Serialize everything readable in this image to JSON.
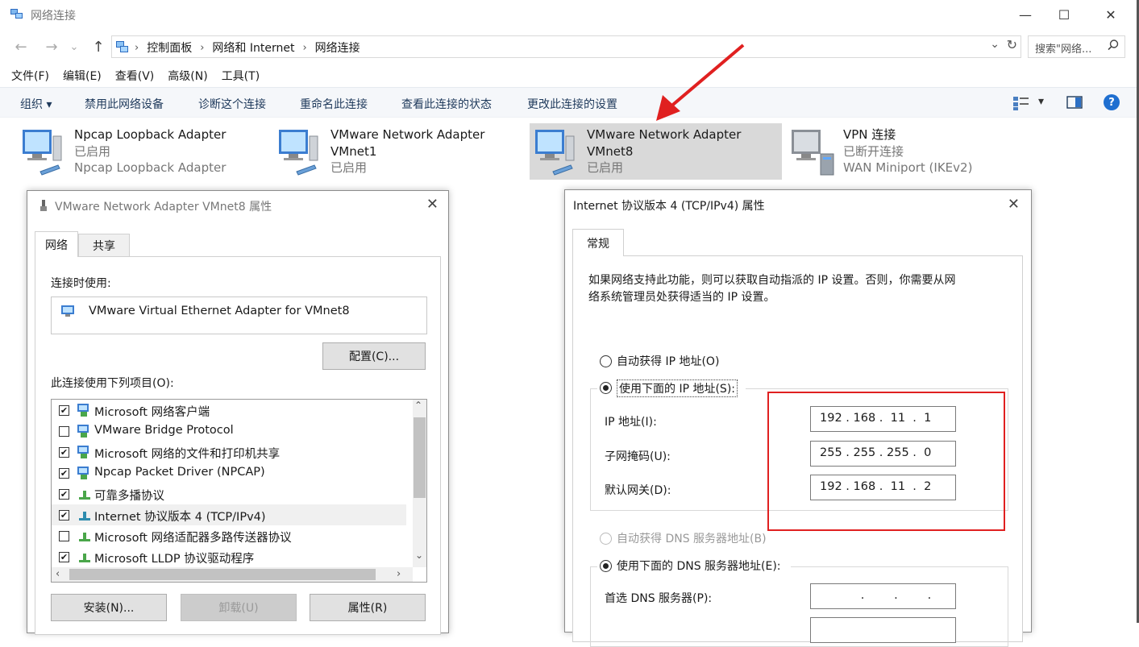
{
  "window": {
    "title": "网络连接",
    "minimize": "—",
    "maximize": "☐",
    "close": "✕"
  },
  "nav": {
    "back": "←",
    "forward": "→",
    "history": "⌄",
    "up": "↑"
  },
  "breadcrumbs": [
    "控制面板",
    "网络和 Internet",
    "网络连接"
  ],
  "breadcrumb_sep": "›",
  "address": {
    "dropdown": "⌄",
    "refresh": "↻"
  },
  "search": {
    "placeholder": "搜索\"网络...",
    "icon": "search-icon"
  },
  "menu": [
    "文件(F)",
    "编辑(E)",
    "查看(V)",
    "高级(N)",
    "工具(T)"
  ],
  "commands": {
    "organize": "组织 ▾",
    "disable": "禁用此网络设备",
    "diagnose": "诊断这个连接",
    "rename": "重命名此连接",
    "view_status": "查看此连接的状态",
    "change_settings": "更改此连接的设置",
    "view_dropdown": "▾"
  },
  "adapters": [
    {
      "line1": "Npcap Loopback Adapter",
      "line2": "已启用",
      "line3": "Npcap Loopback Adapter"
    },
    {
      "line1": "VMware Network Adapter",
      "line2": "VMnet1",
      "line3": "已启用"
    },
    {
      "line1": "VMware Network Adapter",
      "line2": "VMnet8",
      "line3": "已启用"
    },
    {
      "line1": "VPN 连接",
      "line2": "已断开连接",
      "line3": "WAN Miniport (IKEv2)"
    }
  ],
  "props_dialog": {
    "title": "VMware Network Adapter VMnet8 属性",
    "close": "✕",
    "tabs": [
      "网络",
      "共享"
    ],
    "connect_using_label": "连接时使用:",
    "adapter_name": "VMware Virtual Ethernet Adapter for VMnet8",
    "configure_button": "配置(C)...",
    "items_label": "此连接使用下列项目(O):",
    "items": [
      {
        "label": "Microsoft 网络客户端",
        "checked": "✔"
      },
      {
        "label": "VMware Bridge Protocol",
        "checked": ""
      },
      {
        "label": "Microsoft 网络的文件和打印机共享",
        "checked": "✔"
      },
      {
        "label": "Npcap Packet Driver (NPCAP)",
        "checked": "✔"
      },
      {
        "label": "可靠多播协议",
        "checked": "✔"
      },
      {
        "label": "Internet 协议版本 4 (TCP/IPv4)",
        "checked": "✔"
      },
      {
        "label": "Microsoft 网络适配器多路传送器协议",
        "checked": ""
      },
      {
        "label": "Microsoft LLDP 协议驱动程序",
        "checked": "✔"
      }
    ],
    "scroll_up": "⌃",
    "scroll_down": "⌄",
    "scroll_left": "‹",
    "scroll_right": "›",
    "install_button": "安装(N)...",
    "uninstall_button": "卸载(U)",
    "properties_button": "属性(R)"
  },
  "ipv4_dialog": {
    "title": "Internet 协议版本 4 (TCP/IPv4) 属性",
    "close": "✕",
    "tab": "常规",
    "description_line1": "如果网络支持此功能，则可以获取自动指派的 IP 设置。否则，你需要从网",
    "description_line2": "络系统管理员处获得适当的 IP 设置。",
    "auto_ip": "自动获得 IP 地址(O)",
    "manual_ip": "使用下面的 IP 地址(S):",
    "ip_label": "IP 地址(I):",
    "mask_label": "子网掩码(U):",
    "gateway_label": "默认网关(D):",
    "ip_value": "192 . 168 .  11  .  1",
    "mask_value": "255 . 255 . 255 .  0",
    "gateway_value": "192 . 168 .  11  .  2",
    "auto_dns": "自动获得 DNS 服务器地址(B)",
    "manual_dns": "使用下面的 DNS 服务器地址(E):",
    "preferred_dns_label": "首选 DNS 服务器(P):",
    "preferred_dns_value": "           .        .        ."
  },
  "colors": {
    "annotation_red": "#e02020",
    "selection": "#d9d9d9",
    "help_blue": "#1f6fd0"
  }
}
